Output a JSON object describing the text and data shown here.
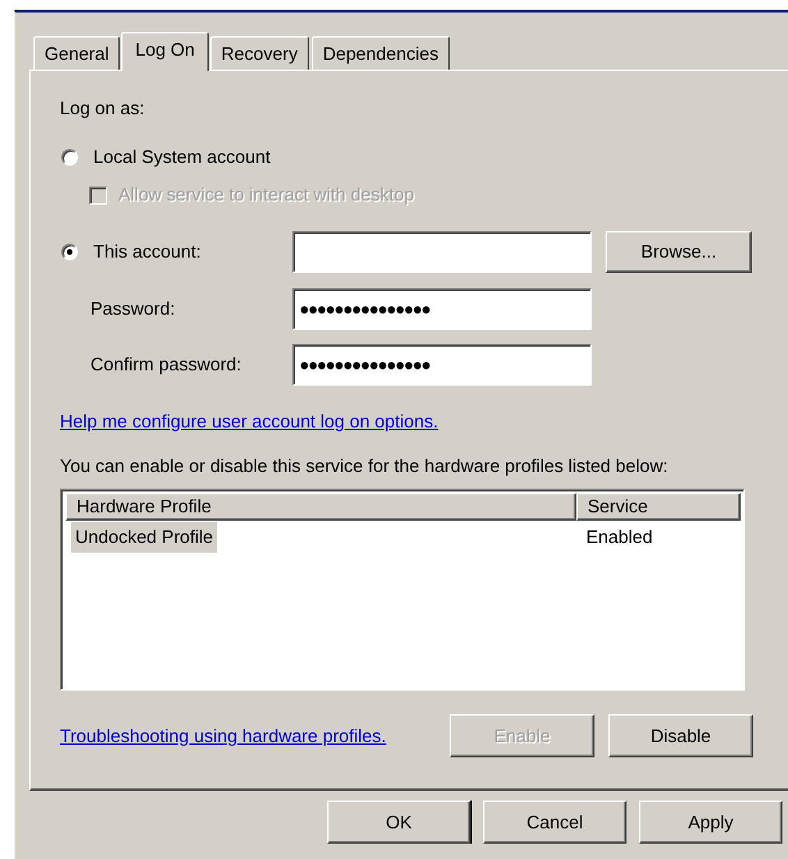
{
  "tabs": [
    {
      "label": "General",
      "selected": false
    },
    {
      "label": "Log On",
      "selected": true
    },
    {
      "label": "Recovery",
      "selected": false
    },
    {
      "label": "Dependencies",
      "selected": false
    }
  ],
  "log_on_as_label": "Log on as:",
  "local_system": {
    "label": "Local System account",
    "selected": false
  },
  "interact_desktop": {
    "label": "Allow service to interact with desktop",
    "checked": false,
    "disabled": true
  },
  "this_account": {
    "label": "This account:",
    "selected": true,
    "browse_button": "Browse..."
  },
  "password": {
    "label": "Password:",
    "value": "●●●●●●●●●●●●●●●"
  },
  "confirm_password": {
    "label": "Confirm password:",
    "value": "●●●●●●●●●●●●●●●"
  },
  "help_link": "Help me configure user account log on options.",
  "profiles_note": "You can enable or disable this service for the hardware profiles listed below:",
  "profiles_table": {
    "columns": [
      "Hardware Profile",
      "Service"
    ],
    "rows": [
      {
        "cells": [
          "Undocked Profile",
          "Enabled"
        ],
        "selected": true
      }
    ]
  },
  "troubleshoot_link": "Troubleshooting using hardware profiles.",
  "profile_buttons": [
    {
      "label": "Enable",
      "disabled": true
    },
    {
      "label": "Disable",
      "disabled": false
    }
  ],
  "dialog_buttons": [
    {
      "label": "OK",
      "default": true
    },
    {
      "label": "Cancel",
      "default": false
    },
    {
      "label": "Apply",
      "default": false
    }
  ]
}
